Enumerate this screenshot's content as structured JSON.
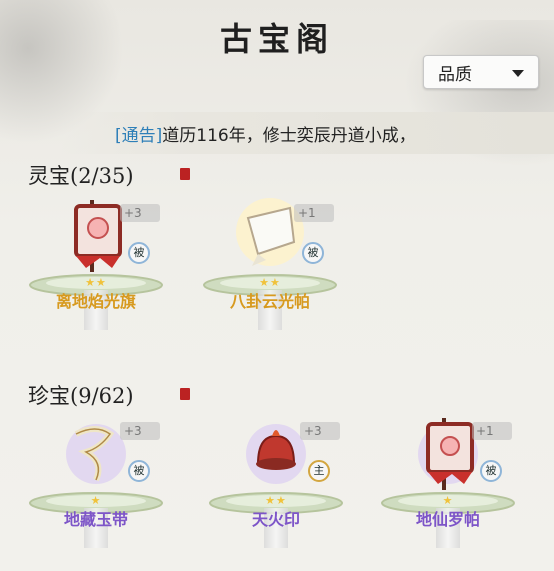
{
  "header": {
    "title": "古宝阁"
  },
  "sort": {
    "label": "品质",
    "icon": "chevron-down-icon"
  },
  "notice": {
    "tag": "[通告]",
    "text": "道历116年，修士奕辰丹道小成，"
  },
  "sections": [
    {
      "title": "灵宝(2/35)",
      "name_color": "#d79a1f",
      "items": [
        {
          "name": "离地焰光旗",
          "count": "+3",
          "badge": "被",
          "stars": "★★",
          "icon": "banner-flag-icon"
        },
        {
          "name": "八卦云光帕",
          "count": "+1",
          "badge": "被",
          "stars": "★★",
          "icon": "cloth-handkerchief-icon"
        }
      ]
    },
    {
      "title": "珍宝(9/62)",
      "name_color": "#7d55c8",
      "items": [
        {
          "name": "地藏玉带",
          "count": "+3",
          "badge": "被",
          "stars": "★",
          "icon": "jade-belt-icon"
        },
        {
          "name": "天火印",
          "count": "+3",
          "badge": "主",
          "stars": "★★",
          "icon": "fire-seal-icon"
        },
        {
          "name": "地仙罗帕",
          "count": "+1",
          "badge": "被",
          "stars": "★",
          "icon": "silk-banner-icon"
        }
      ]
    }
  ]
}
